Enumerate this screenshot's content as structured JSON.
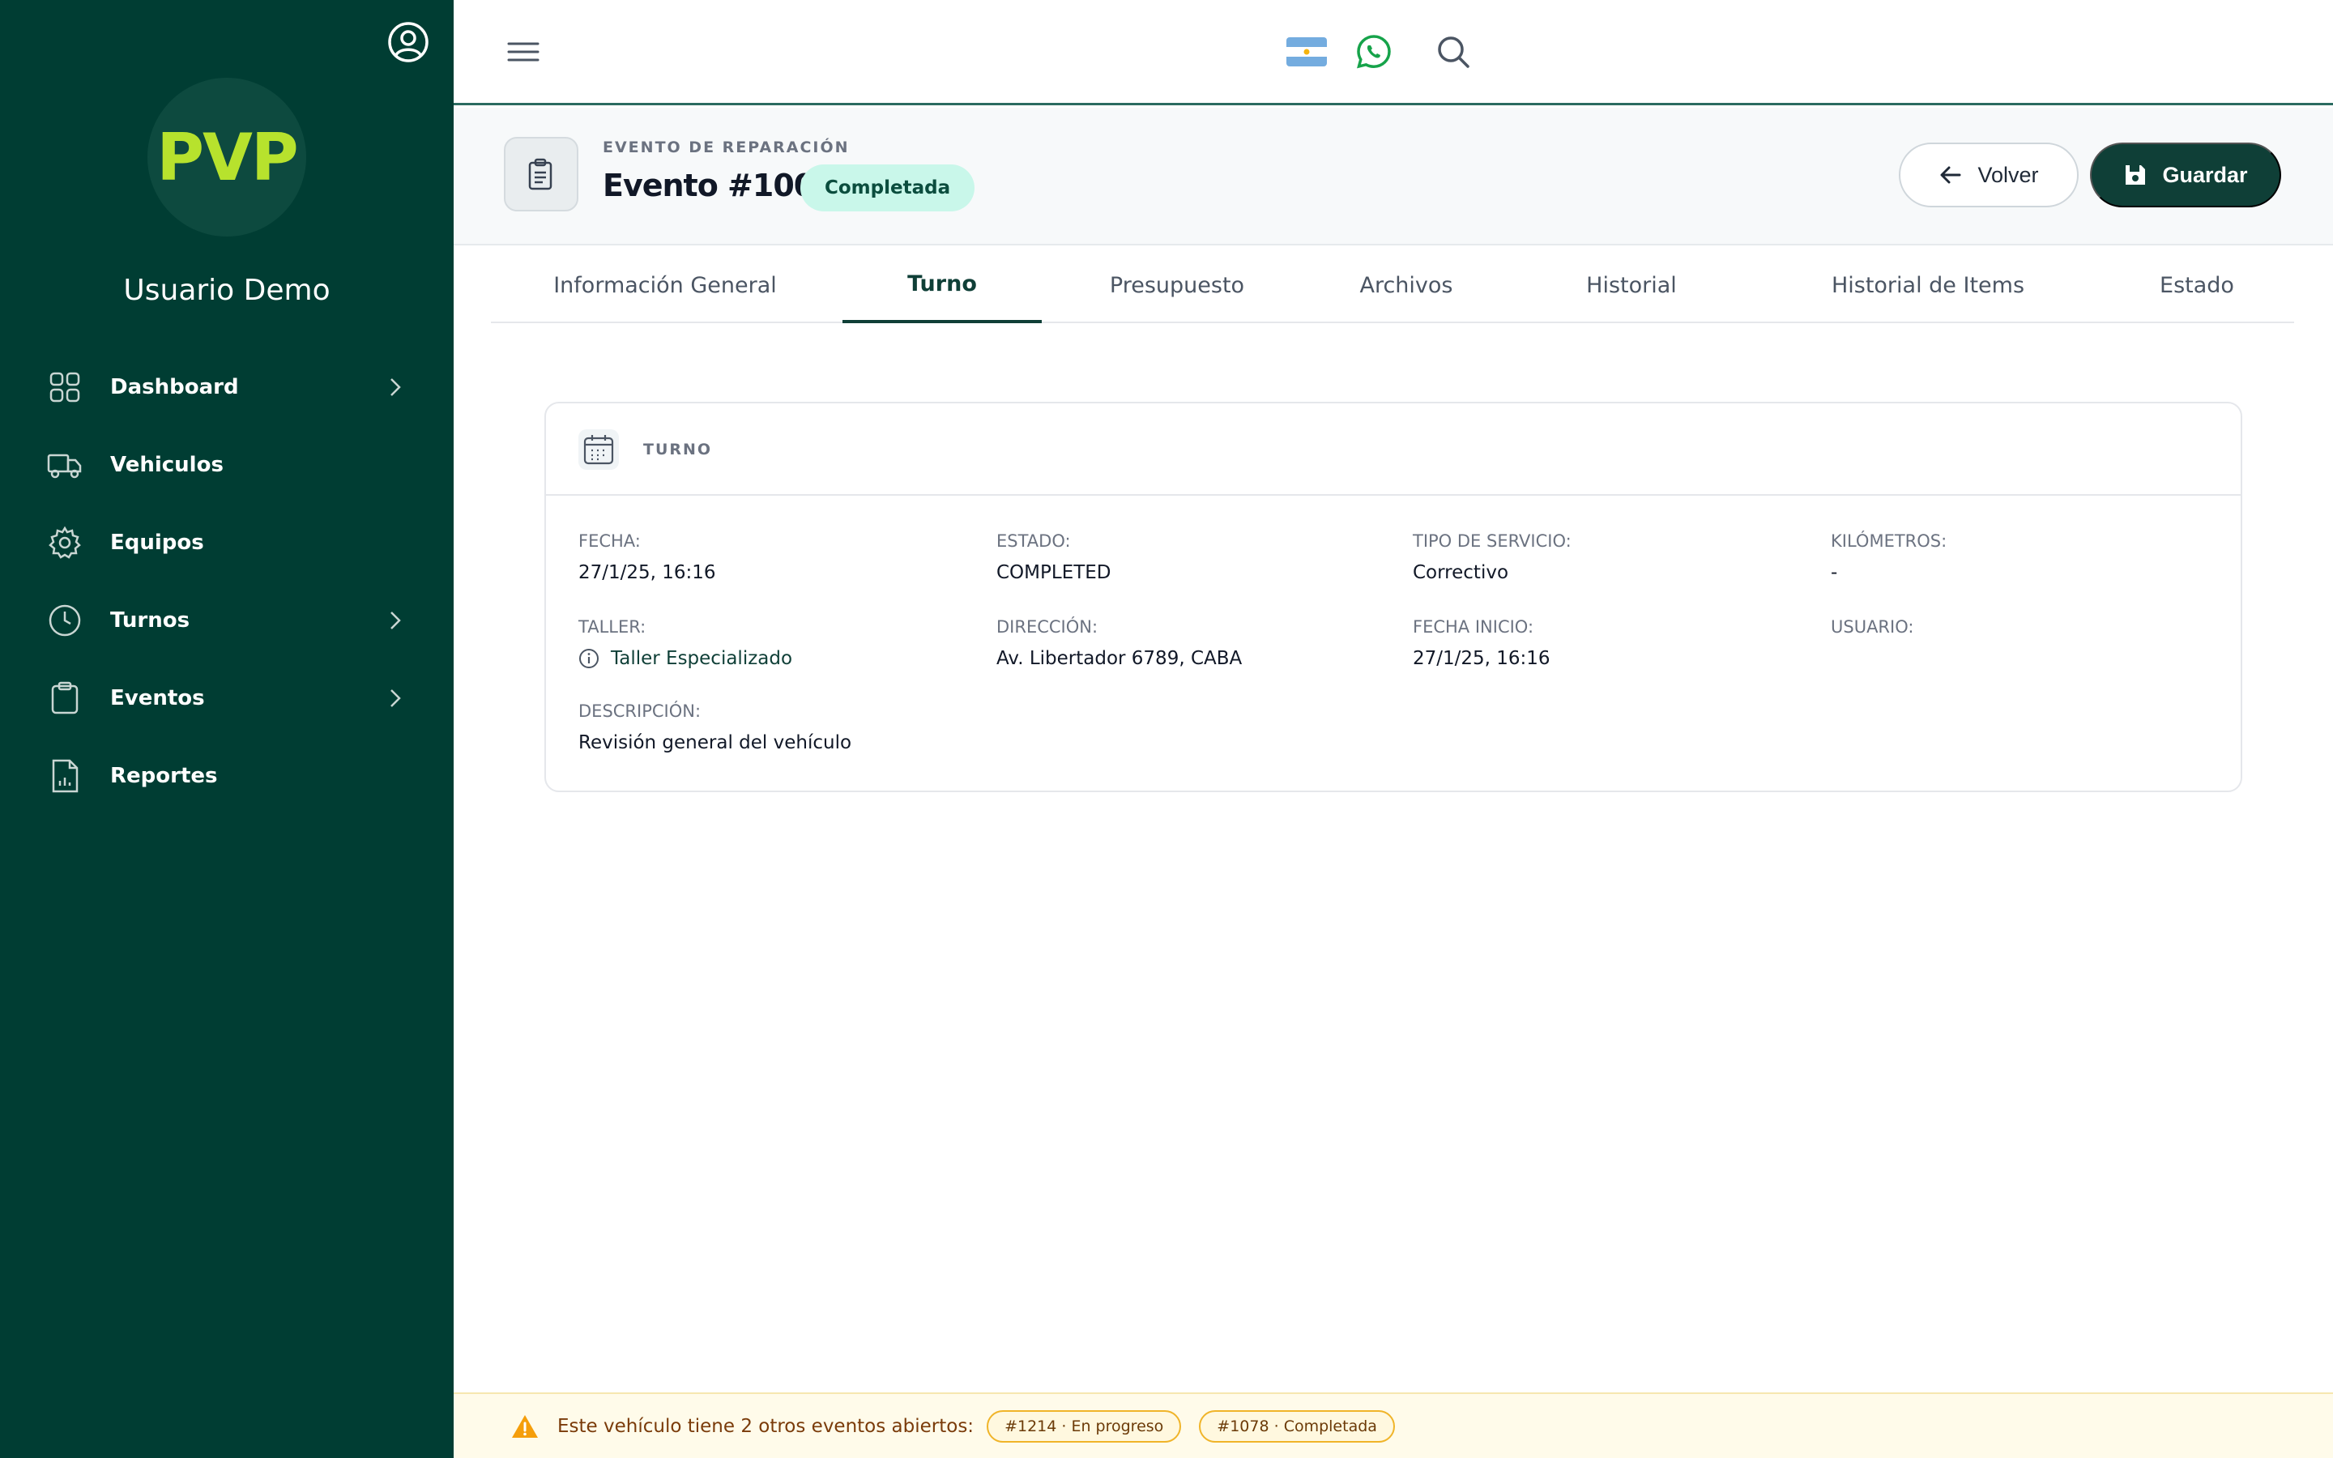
{
  "sidebar": {
    "logo_text": "PVP",
    "username": "Usuario Demo",
    "items": [
      {
        "label": "Dashboard",
        "icon": "grid-icon",
        "chevron": true
      },
      {
        "label": "Vehiculos",
        "icon": "truck-icon",
        "chevron": false
      },
      {
        "label": "Equipos",
        "icon": "gear-icon",
        "chevron": false
      },
      {
        "label": "Turnos",
        "icon": "clock-icon",
        "chevron": true
      },
      {
        "label": "Eventos",
        "icon": "clipboard-icon",
        "chevron": true
      },
      {
        "label": "Reportes",
        "icon": "report-icon",
        "chevron": false
      }
    ]
  },
  "header": {
    "icons": [
      "menu-icon",
      "argentina-flag-icon",
      "whatsapp-icon",
      "search-icon"
    ]
  },
  "event": {
    "subtitle": "EVENTO DE REPARACIÓN",
    "title": "Evento #1004",
    "status": "Completada",
    "back_label": "Volver",
    "save_label": "Guardar"
  },
  "tabs": [
    {
      "label": "Información General",
      "active": false
    },
    {
      "label": "Turno",
      "active": true
    },
    {
      "label": "Presupuesto",
      "active": false
    },
    {
      "label": "Archivos",
      "active": false
    },
    {
      "label": "Historial",
      "active": false
    },
    {
      "label": "Historial de Items",
      "active": false
    },
    {
      "label": "Estado",
      "active": false
    }
  ],
  "card": {
    "title": "TURNO",
    "fields": {
      "fecha": {
        "label": "FECHA:",
        "value": "27/1/25, 16:16"
      },
      "estado": {
        "label": "ESTADO:",
        "value": "COMPLETED"
      },
      "tipo_servicio": {
        "label": "TIPO DE SERVICIO:",
        "value": "Correctivo"
      },
      "kilometros": {
        "label": "KILÓMETROS:",
        "value": "-"
      },
      "taller": {
        "label": "TALLER:",
        "value": "Taller Especializado"
      },
      "direccion": {
        "label": "DIRECCIÓN:",
        "value": "Av. Libertador 6789, CABA"
      },
      "fecha_inicio": {
        "label": "FECHA INICIO:",
        "value": "27/1/25, 16:16"
      },
      "usuario": {
        "label": "USUARIO:",
        "value": ""
      },
      "descripcion": {
        "label": "DESCRIPCIÓN:",
        "value": "Revisión general del vehículo"
      }
    }
  },
  "warning": {
    "text": "Este vehículo tiene 2 otros eventos abiertos:",
    "chips": [
      "#1214 · En progreso",
      "#1078 · Completada"
    ]
  },
  "colors": {
    "sidebar_bg": "#003d33",
    "primary": "#0f3f37",
    "logo": "#b7e22d",
    "status_pill_bg": "#c9f7ea",
    "warning_bg": "#fffbea",
    "warning_border": "#f0b429"
  }
}
